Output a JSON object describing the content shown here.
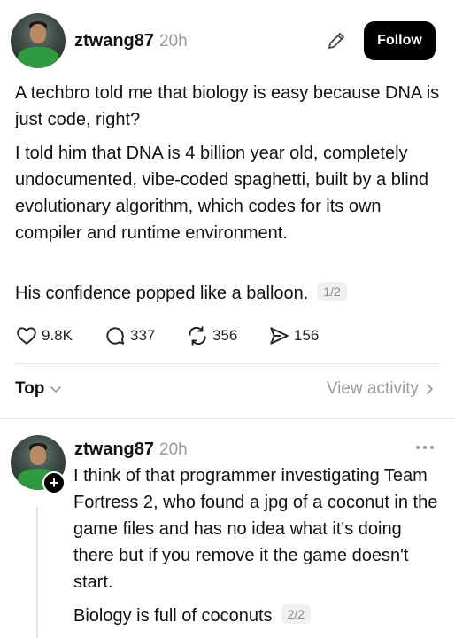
{
  "post": {
    "username": "ztwang87",
    "time": "20h",
    "follow_label": "Follow",
    "paragraph1": "A techbro told me that biology is easy because DNA is just code, right?",
    "paragraph2": "I told him that DNA is 4 billion year old, completely undocumented, vibe-coded spaghetti, built by a blind evolutionary algorithm, which codes for its own compiler and runtime environment.",
    "paragraph3": "His confidence popped like a balloon.",
    "pager": "1/2",
    "likes": "9.8K",
    "replies": "337",
    "reposts": "356",
    "shares": "156"
  },
  "feed_controls": {
    "sort_label": "Top",
    "view_activity_label": "View activity"
  },
  "reply": {
    "username": "ztwang87",
    "time": "20h",
    "paragraph1": "I think of that programmer investigating Team Fortress 2, who found a jpg of a coconut in the game files and has no idea what it's doing there but if you remove it the game doesn't start.",
    "paragraph2": "Biology is full of coconuts",
    "pager": "2/2"
  },
  "icons": {
    "edit": "pencil-icon",
    "like": "heart-icon",
    "reply": "comment-bubble-icon",
    "repost": "repost-arrows-icon",
    "share": "send-icon",
    "sort": "chevron-down-icon",
    "view_activity": "chevron-right-icon",
    "more": "more-dots-icon",
    "add": "plus-icon"
  },
  "colors": {
    "text": "#111111",
    "muted": "#9a9a9a",
    "follow_button": "#000000"
  }
}
